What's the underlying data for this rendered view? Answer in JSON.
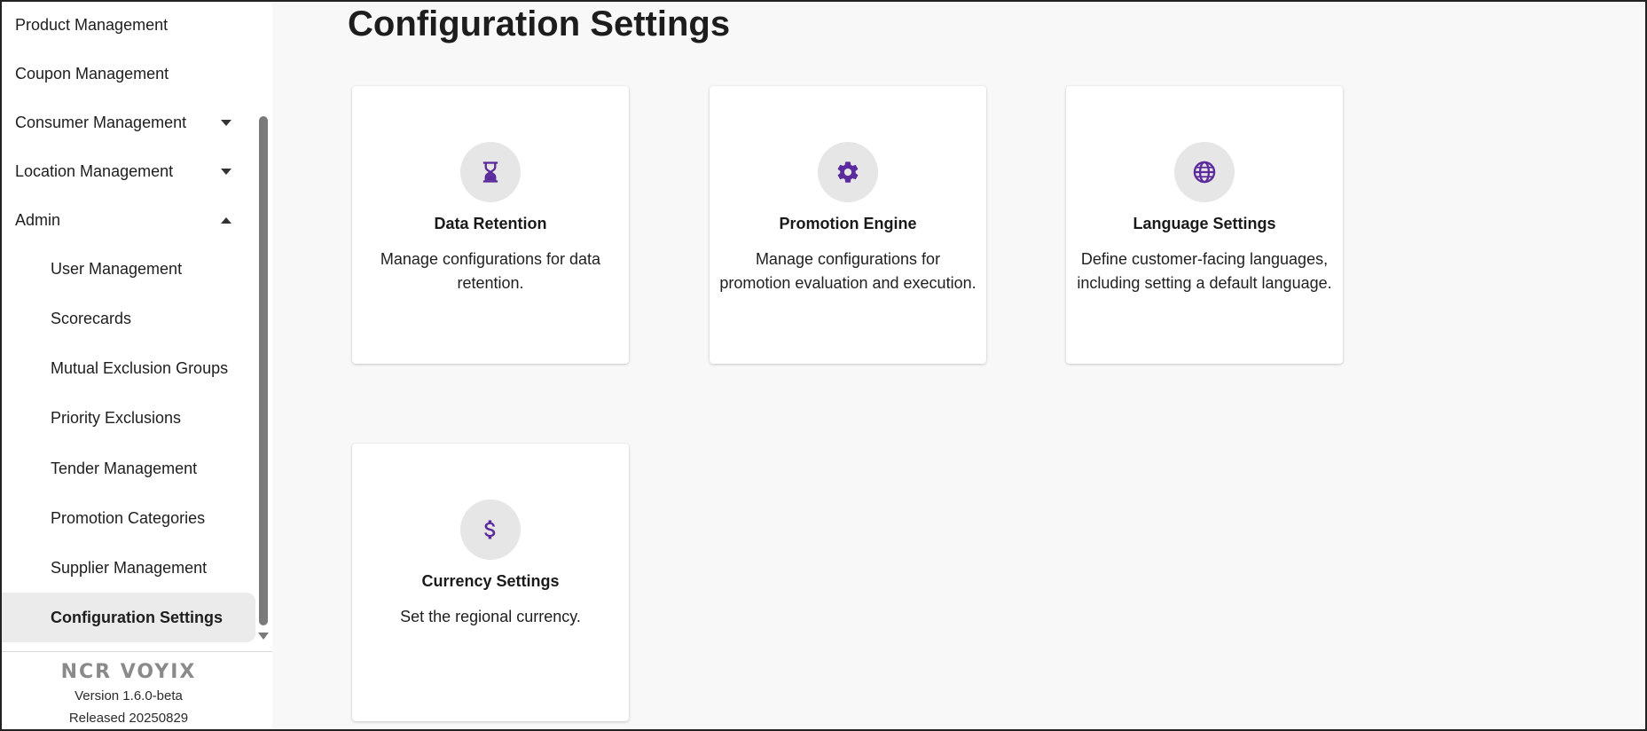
{
  "sidebar": {
    "items": [
      {
        "label": "Product Management",
        "expandable": false
      },
      {
        "label": "Coupon Management",
        "expandable": false
      },
      {
        "label": "Consumer Management",
        "expandable": true,
        "expanded": false
      },
      {
        "label": "Location Management",
        "expandable": true,
        "expanded": false
      },
      {
        "label": "Admin",
        "expandable": true,
        "expanded": true
      }
    ],
    "admin_children": [
      {
        "label": "User Management"
      },
      {
        "label": "Scorecards"
      },
      {
        "label": "Mutual Exclusion Groups"
      },
      {
        "label": "Priority Exclusions"
      },
      {
        "label": "Tender Management"
      },
      {
        "label": "Promotion Categories"
      },
      {
        "label": "Supplier Management"
      },
      {
        "label": "Configuration Settings",
        "active": true
      }
    ]
  },
  "brand": {
    "logo_text": "NCR VOYIX",
    "version": "Version 1.6.0-beta",
    "released": "Released 20250829"
  },
  "page": {
    "title": "Configuration Settings"
  },
  "cards": [
    {
      "icon": "hourglass-icon",
      "title": "Data Retention",
      "description": "Manage configurations for data retention."
    },
    {
      "icon": "gear-icon",
      "title": "Promotion Engine",
      "description": "Manage configurations for promotion evaluation and execution."
    },
    {
      "icon": "globe-icon",
      "title": "Language Settings",
      "description": "Define customer-facing languages, including setting a default language."
    },
    {
      "icon": "dollar-icon",
      "title": "Currency Settings",
      "description": "Set the regional currency."
    }
  ],
  "colors": {
    "icon_accent": "#5b2a9c",
    "active_item_bg": "#ebebeb",
    "icon_circle_bg": "#e6e6e6"
  }
}
